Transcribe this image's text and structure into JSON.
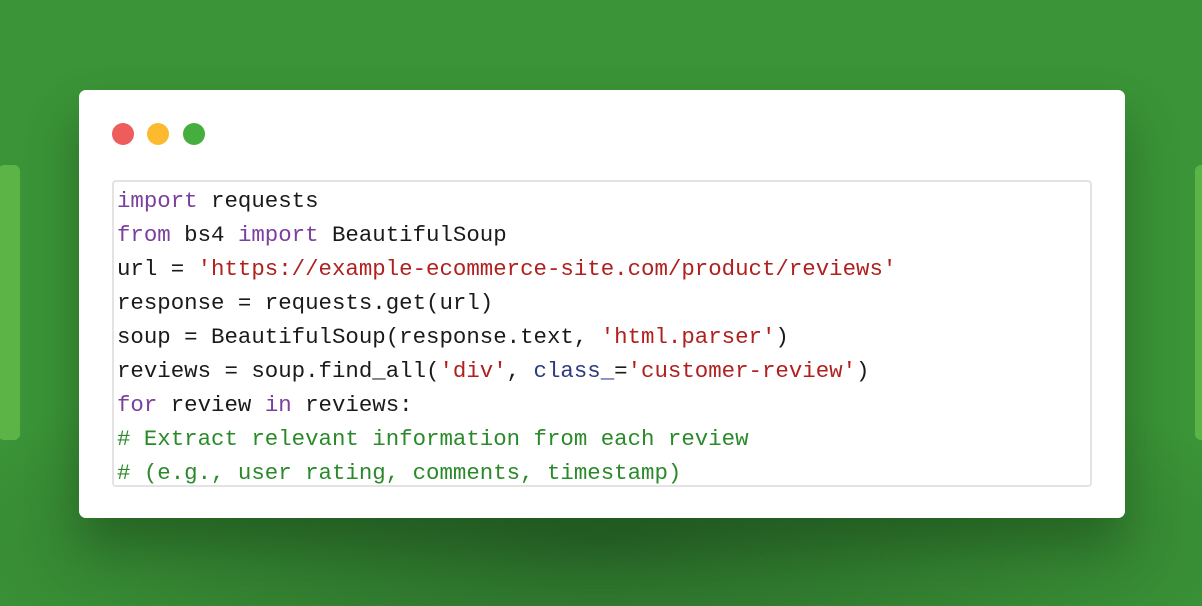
{
  "colors": {
    "background": "#3b9437",
    "close": "#ee5c5c",
    "minimize": "#fcbb2e",
    "maximize": "#46ae3e",
    "keyword": "#7b3f9e",
    "string": "#b0201f",
    "comment": "#2a8a2a",
    "param": "#2e3a80"
  },
  "window_controls": [
    "close",
    "minimize",
    "maximize"
  ],
  "code": {
    "l1": {
      "k1": "import",
      "t1": " requests"
    },
    "l2": {
      "k1": "from",
      "t1": " bs4 ",
      "k2": "import",
      "t2": " BeautifulSoup"
    },
    "l3": {
      "t1": "url = ",
      "s1": "'https://example-ecommerce-site.com/product/reviews'"
    },
    "l4": {
      "t1": "response = requests.get(url)"
    },
    "l5": {
      "t1": "soup = BeautifulSoup(response.text, ",
      "s1": "'html.parser'",
      "t2": ")"
    },
    "l6": {
      "t1": "reviews = soup.find_all(",
      "s1": "'div'",
      "t2": ", ",
      "p1": "class_",
      "t3": "=",
      "s2": "'customer-review'",
      "t4": ")"
    },
    "l7": {
      "k1": "for",
      "t1": " review ",
      "k2": "in",
      "t2": " reviews:"
    },
    "l8": {
      "c1": "# Extract relevant information from each review"
    },
    "l9": {
      "c1": "# (e.g., user rating, comments, timestamp)"
    }
  }
}
